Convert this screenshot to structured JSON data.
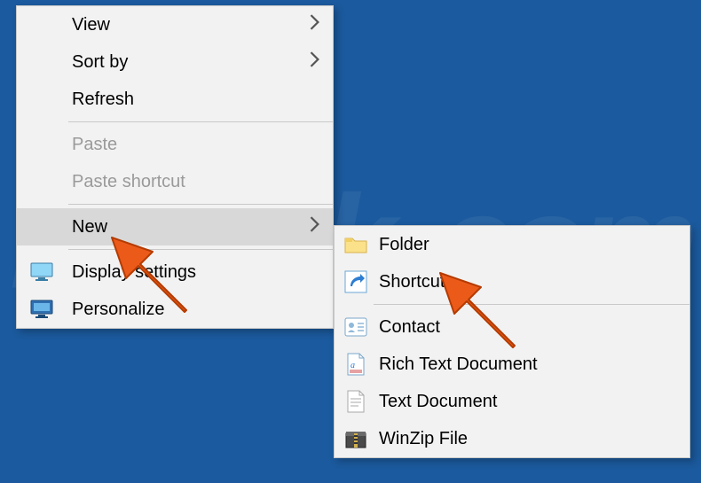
{
  "watermark": "PCrisk.com",
  "main_menu": {
    "view": "View",
    "sort_by": "Sort by",
    "refresh": "Refresh",
    "paste": "Paste",
    "paste_shortcut": "Paste shortcut",
    "new": "New",
    "display_settings": "Display settings",
    "personalize": "Personalize"
  },
  "sub_menu": {
    "folder": "Folder",
    "shortcut": "Shortcut",
    "contact": "Contact",
    "rtf": "Rich Text Document",
    "txt": "Text Document",
    "winzip": "WinZip File"
  }
}
